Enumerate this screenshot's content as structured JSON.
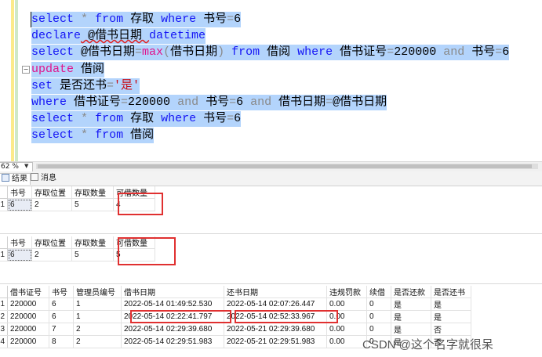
{
  "editor": {
    "lines": [
      {
        "parts": [
          {
            "t": "select",
            "c": "kw"
          },
          {
            "t": " "
          },
          {
            "t": "*",
            "c": "gray"
          },
          {
            "t": " "
          },
          {
            "t": "from",
            "c": "kw"
          },
          {
            "t": " 存取 "
          },
          {
            "t": "where",
            "c": "kw"
          },
          {
            "t": " 书号"
          },
          {
            "t": "=",
            "c": "gray"
          },
          {
            "t": "6"
          }
        ]
      },
      {
        "parts": [
          {
            "t": "declare",
            "c": "kw"
          },
          {
            "t": " @借书日期 "
          },
          {
            "t": "datetime",
            "c": "kw"
          }
        ]
      },
      {
        "parts": [
          {
            "t": "select",
            "c": "kw"
          },
          {
            "t": " @借书日期"
          },
          {
            "t": "=",
            "c": "gray"
          },
          {
            "t": "max",
            "c": "pink"
          },
          {
            "t": "(",
            "c": "gray"
          },
          {
            "t": "借书日期"
          },
          {
            "t": ")",
            "c": "gray"
          },
          {
            "t": " "
          },
          {
            "t": "from",
            "c": "kw"
          },
          {
            "t": " 借阅 "
          },
          {
            "t": "where",
            "c": "kw"
          },
          {
            "t": " 借书证号"
          },
          {
            "t": "=",
            "c": "gray"
          },
          {
            "t": "220000 "
          },
          {
            "t": "and",
            "c": "gray"
          },
          {
            "t": " 书号"
          },
          {
            "t": "=",
            "c": "gray"
          },
          {
            "t": "6"
          }
        ]
      },
      {
        "parts": [
          {
            "t": "update",
            "c": "pink"
          },
          {
            "t": " 借阅"
          }
        ]
      },
      {
        "parts": [
          {
            "t": "set",
            "c": "kw"
          },
          {
            "t": " 是否还书"
          },
          {
            "t": "=",
            "c": "gray"
          },
          {
            "t": "'是'",
            "c": "red"
          }
        ]
      },
      {
        "parts": [
          {
            "t": "where",
            "c": "kw"
          },
          {
            "t": " 借书证号"
          },
          {
            "t": "=",
            "c": "gray"
          },
          {
            "t": "220000 "
          },
          {
            "t": "and",
            "c": "gray"
          },
          {
            "t": " 书号"
          },
          {
            "t": "=",
            "c": "gray"
          },
          {
            "t": "6 "
          },
          {
            "t": "and",
            "c": "gray"
          },
          {
            "t": " 借书日期"
          },
          {
            "t": "=",
            "c": "gray"
          },
          {
            "t": "@借书日期"
          }
        ]
      },
      {
        "parts": [
          {
            "t": "select",
            "c": "kw"
          },
          {
            "t": " "
          },
          {
            "t": "*",
            "c": "gray"
          },
          {
            "t": " "
          },
          {
            "t": "from",
            "c": "kw"
          },
          {
            "t": " 存取 "
          },
          {
            "t": "where",
            "c": "kw"
          },
          {
            "t": " 书号"
          },
          {
            "t": "=",
            "c": "gray"
          },
          {
            "t": "6"
          }
        ]
      },
      {
        "parts": [
          {
            "t": "select",
            "c": "kw"
          },
          {
            "t": " "
          },
          {
            "t": "*",
            "c": "gray"
          },
          {
            "t": " "
          },
          {
            "t": "from",
            "c": "kw"
          },
          {
            "t": " 借阅"
          }
        ]
      }
    ]
  },
  "zoom": {
    "value": "62 %"
  },
  "tabs": {
    "results": "结果",
    "messages": "消息"
  },
  "grid1": {
    "headers": [
      "书号",
      "存取位置",
      "存取数量",
      "可借数量"
    ],
    "rows": [
      {
        "rownum": "1",
        "cells": [
          "6",
          "2",
          "5",
          "4"
        ]
      }
    ]
  },
  "grid2": {
    "headers": [
      "书号",
      "存取位置",
      "存取数量",
      "可借数量"
    ],
    "rows": [
      {
        "rownum": "1",
        "cells": [
          "6",
          "2",
          "5",
          "5"
        ]
      }
    ]
  },
  "grid3": {
    "headers": [
      "借书证号",
      "书号",
      "管理员编号",
      "借书日期",
      "还书日期",
      "违规罚款",
      "续借",
      "是否还款",
      "是否还书"
    ],
    "rows": [
      {
        "rownum": "1",
        "cells": [
          "220000",
          "6",
          "1",
          "2022-05-14 01:49:52.530",
          "2022-05-14 02:07:26.447",
          "0.00",
          "0",
          "是",
          "是"
        ]
      },
      {
        "rownum": "2",
        "cells": [
          "220000",
          "6",
          "1",
          "2022-05-14 02:22:41.797",
          "2022-05-14 02:52:33.967",
          "0.00",
          "0",
          "是",
          "是"
        ]
      },
      {
        "rownum": "3",
        "cells": [
          "220000",
          "7",
          "2",
          "2022-05-14 02:29:39.680",
          "2022-05-21 02:29:39.680",
          "0.00",
          "0",
          "是",
          "否"
        ]
      },
      {
        "rownum": "4",
        "cells": [
          "220000",
          "8",
          "2",
          "2022-05-14 02:29:51.983",
          "2022-05-21 02:29:51.983",
          "0.00",
          "0",
          "是",
          "否"
        ]
      }
    ]
  },
  "watermark": {
    "text": "CSDN @这个名字就很呆"
  },
  "colors": {
    "keyword": "#1515f5",
    "function": "#e0148c",
    "string": "#c8101a",
    "operator": "#8a8a8a",
    "selection": "#b3d4fc",
    "highlight_box": "#e03030"
  }
}
